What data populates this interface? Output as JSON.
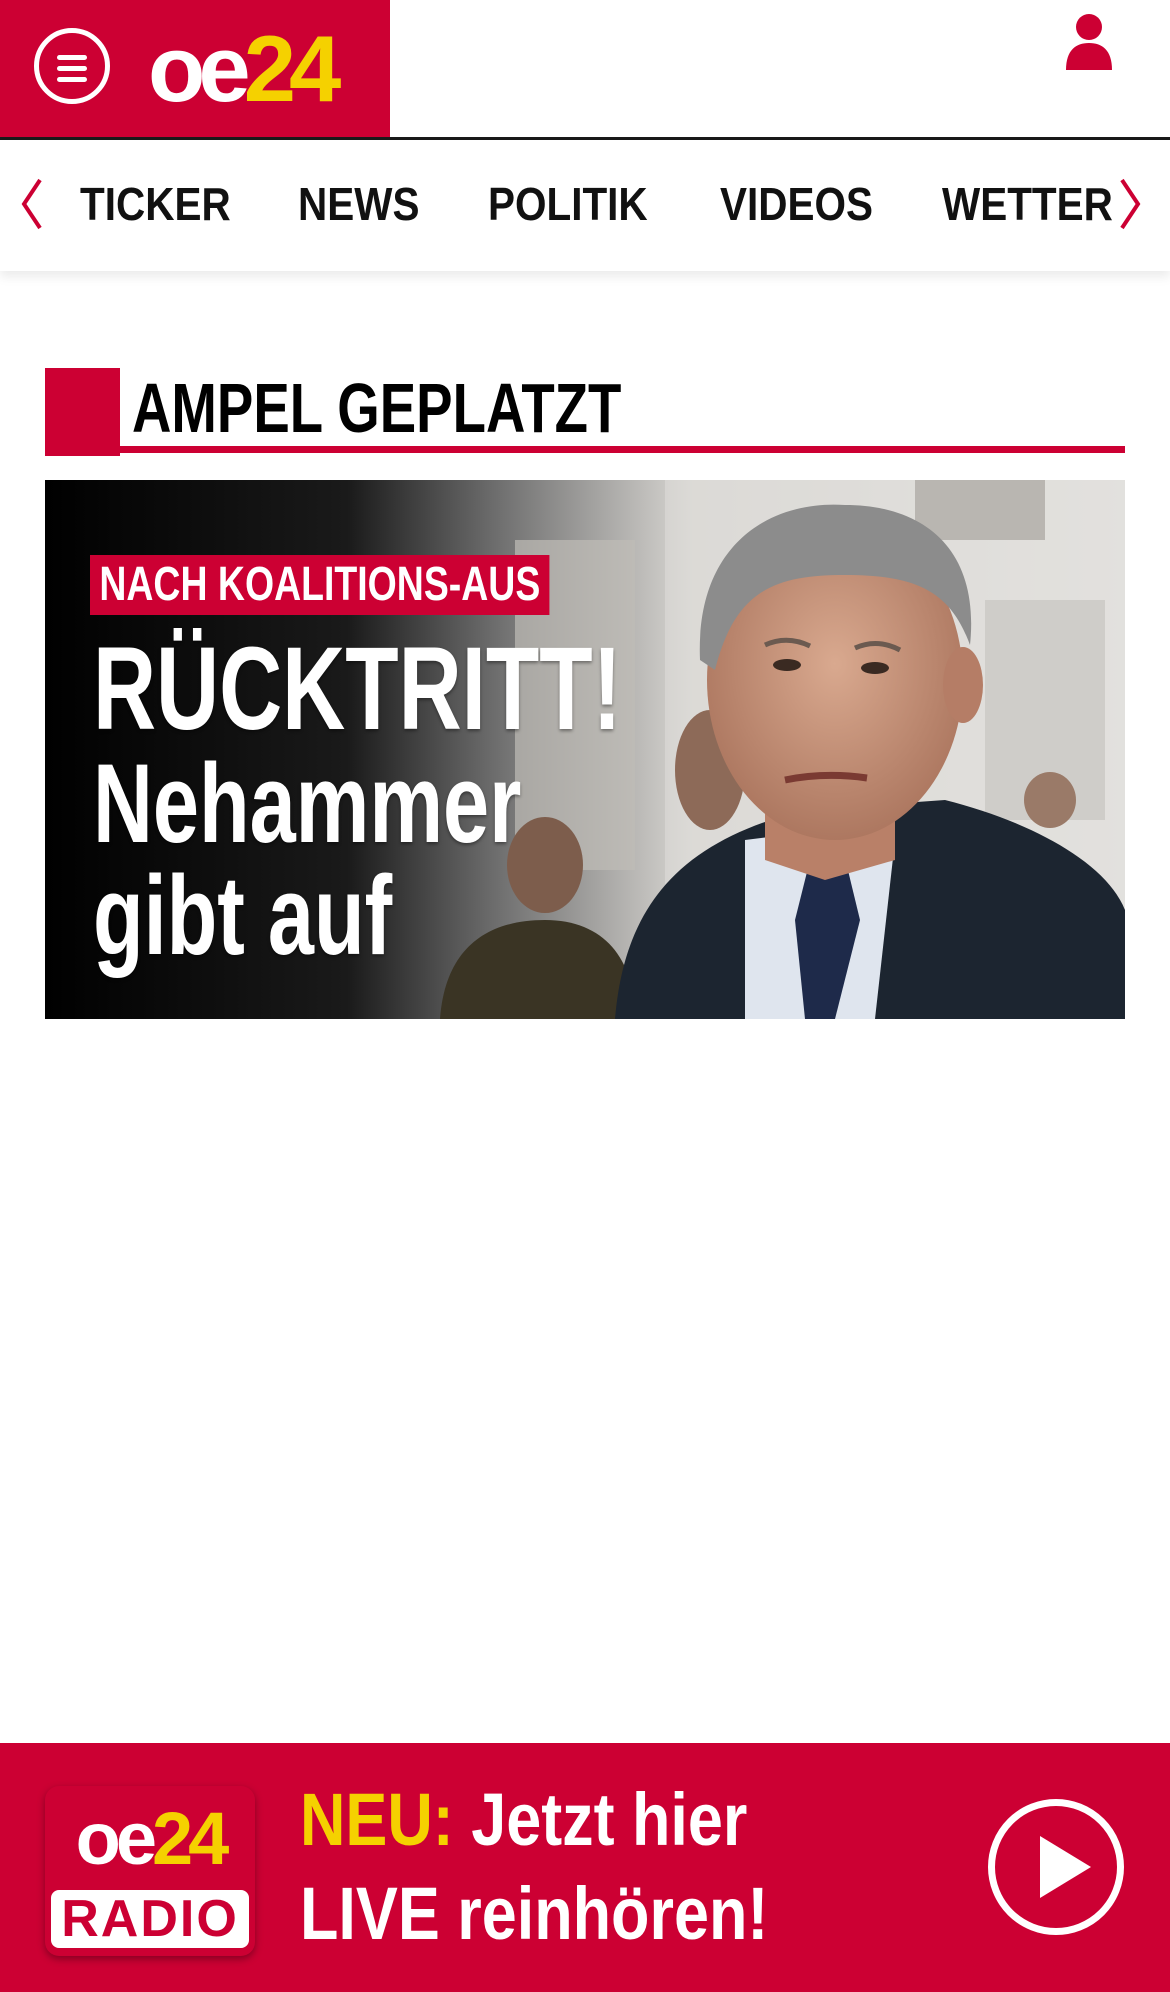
{
  "header": {
    "logo_oe": "oe",
    "logo_num": "24",
    "brand_color": "#cc0033",
    "accent_yellow": "#f5d100"
  },
  "nav": {
    "items": [
      "TICKER",
      "NEWS",
      "POLITIK",
      "VIDEOS",
      "WETTER"
    ]
  },
  "section": {
    "title": "AMPEL GEPLATZT"
  },
  "hero": {
    "kicker": "NACH KOALITIONS-AUS",
    "headline_1": "RÜCKTRITT!",
    "headline_2": "Nehammer",
    "headline_3": "gibt auf"
  },
  "radio": {
    "logo_oe": "oe",
    "logo_num": "24",
    "logo_label": "RADIO",
    "neu": "NEU:",
    "line_1_rest": " Jetzt hier",
    "line_2": "LIVE reinhören!"
  }
}
